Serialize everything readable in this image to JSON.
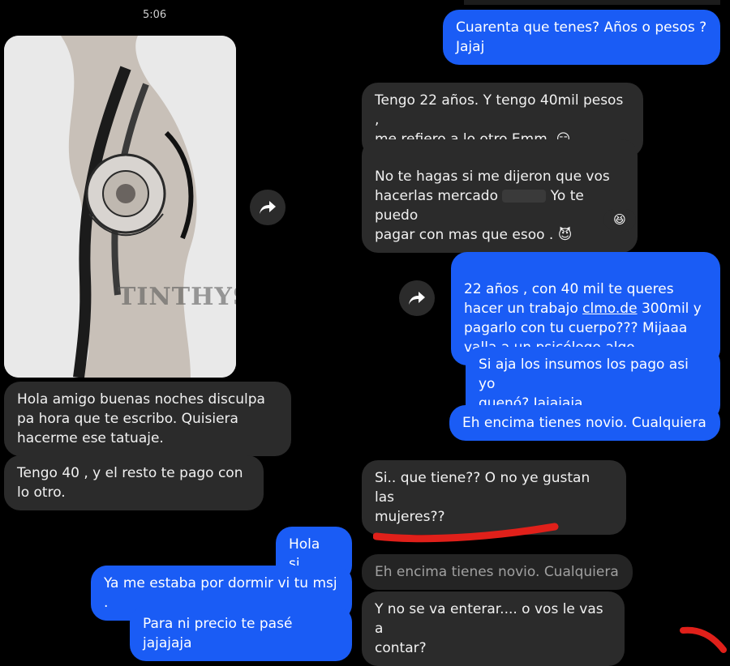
{
  "left": {
    "time": "5:06",
    "messages": [
      "Hola amigo buenas noches disculpa pa hora que te escribo. Quisiera hacerme ese tatuaje.",
      "Tengo 40 , y el resto te pago con lo otro."
    ],
    "photo_watermark": "TINTHYSE",
    "replies": [
      "Hola si.",
      "Ya me estaba por dormir vi tu msj .",
      "Para ni precio te pasé jajajaja"
    ]
  },
  "right": {
    "msg1": "Cuarenta que tenes? Años o pesos ?\nJajaj",
    "msg2": "Tengo 22 años. Y tengo 40mil pesos ,\nme refiero a lo otro Emm. 😏",
    "msg3_a": "No te hagas si me dijeron que vos\nhacerlas mercado ",
    "msg3_b": " Yo te puedo\npagar con mas que esoo . 😈",
    "reaction": "😆",
    "msg4_a": "22 años , con 40 mil te queres\nhacer un trabajo ",
    "msg4_link": "clmo.de",
    "msg4_b": " 300mil y\npagarlo con tu cuerpo??? Mijaaa\nvalla a un psicólogo algo.",
    "msg5": "Si aja los insumos los pago asi yo\nquenó?  Jajajaja",
    "msg6": "Eh encima tienes novio. Cualquiera",
    "msg7": "Si.. que tiene?? O no ye gustan las\nmujeres??",
    "msg8": "Eh encima tienes novio. Cualquiera",
    "msg9": "Y no se va enterar.... o vos le vas a\ncontar?"
  },
  "icons": [
    "forward-arrow-icon",
    "squinting-laugh-emoji",
    "smirk-emoji",
    "devil-emoji"
  ],
  "colors": {
    "sent": "#1a5cf5",
    "received": "#2b2b2b",
    "background": "#000000",
    "annotation_red": "#e0201a"
  }
}
